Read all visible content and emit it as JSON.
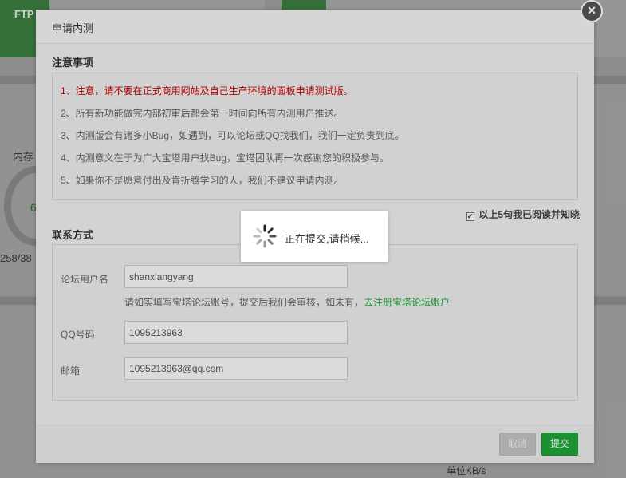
{
  "background": {
    "top_card_label": "FTP",
    "memory_label": "内存",
    "memory_gauge_value": "6",
    "memory_numbers": "258/38",
    "unit_label": "单位KB/s"
  },
  "modal": {
    "title": "申请内测",
    "close_symbol": "×",
    "notice": {
      "title": "注意事项",
      "lines": [
        "1、注意，请不要在正式商用网站及自己生产环境的面板申请测试版。",
        "2、所有新功能做完内部初审后都会第一时间向所有内测用户推送。",
        "3、内测版会有诸多小Bug，如遇到，可以论坛或QQ找我们，我们一定负责到底。",
        "4、内测意义在于为广大宝塔用户找Bug，宝塔团队再一次感谢您的积极参与。",
        "5、如果你不是愿意付出及肯折腾学习的人，我们不建议申请内测。"
      ]
    },
    "agree": {
      "checked": true,
      "check_mark": "✔",
      "label": "以上5句我已阅读并知晓"
    },
    "contact": {
      "title": "联系方式",
      "username_label": "论坛用户名",
      "username_value": "shanxiangyang",
      "hint_text": "请如实填写宝塔论坛账号，提交后我们会审核，如未有，",
      "hint_link": "去注册宝塔论坛账户",
      "qq_label": "QQ号码",
      "qq_value": "1095213963",
      "email_label": "邮箱",
      "email_value": "1095213963@qq.com"
    },
    "footer": {
      "cancel_label": "取消",
      "submit_label": "提交"
    }
  },
  "loading": {
    "text": "正在提交,请稍候..."
  },
  "colors": {
    "accent_green": "#20a53a",
    "warning_red": "#cc0000"
  },
  "icons": {
    "close": "close-icon",
    "spinner": "spinner-icon",
    "checkbox": "checkbox-checked-icon"
  }
}
